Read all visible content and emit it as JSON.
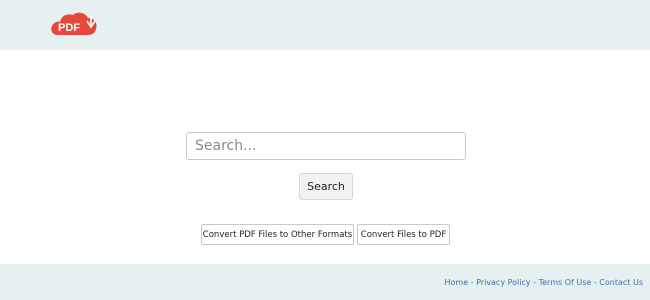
{
  "header": {
    "logo_text": "PDF",
    "logo_color": "#e8473e"
  },
  "search": {
    "placeholder": "Search...",
    "button_label": "Search"
  },
  "convert": {
    "pdf_to_other_label": "Convert PDF Files to Other Formats",
    "files_to_pdf_label": "Convert Files to PDF"
  },
  "footer": {
    "links": [
      "Home",
      "Privacy Policy",
      "Terms Of Use",
      "Contact Us"
    ],
    "separator": " - ",
    "link_color": "#3b6fb0"
  },
  "colors": {
    "band_background": "#e7f0f1",
    "page_background": "#ffffff"
  }
}
